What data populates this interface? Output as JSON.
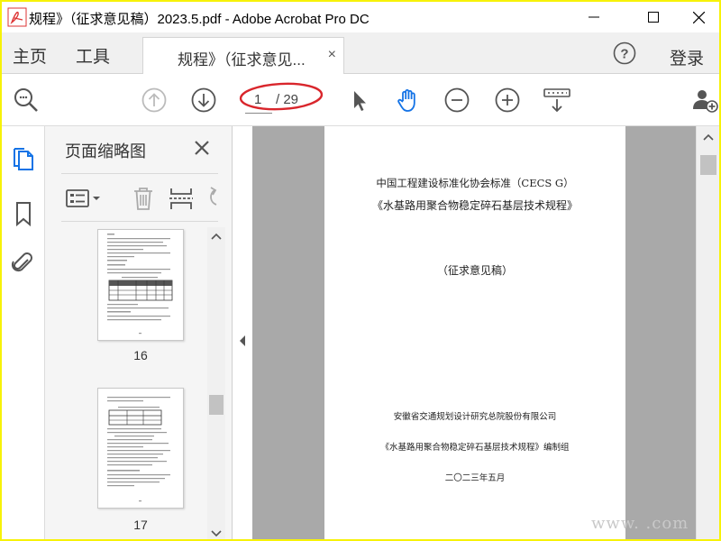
{
  "window": {
    "title": "规程》（征求意见稿）2023.5.pdf - Adobe Acrobat Pro DC",
    "minimize_icon": "minimize-icon",
    "maximize_icon": "maximize-icon",
    "close_icon": "close-icon",
    "frame_color": "#f7f208"
  },
  "tabs": {
    "home": "主页",
    "tools": "工具",
    "document": "规程》（征求意见...",
    "close": "×",
    "login": "登录"
  },
  "toolbar": {
    "current_page": "1",
    "total_pages": "/ 29",
    "icons": [
      "zoom-search-icon",
      "page-up-icon",
      "page-down-icon",
      "select-cursor-icon",
      "hand-tool-icon",
      "zoom-out-icon",
      "zoom-in-icon",
      "keyboard-scroll-icon",
      "share-user-icon"
    ],
    "active_color": "#1473e6"
  },
  "panel": {
    "title": "页面缩略图",
    "thumbnails": [
      {
        "page": "16"
      },
      {
        "page": "17"
      }
    ]
  },
  "document": {
    "line1": "中国工程建设标准化协会标准（CECS G）",
    "line2": "《水基路用聚合物稳定碎石基层技术规程》",
    "line3": "（征求意见稿）",
    "line4": "安徽省交通规划设计研究总院股份有限公司",
    "line5": "《水基路用聚合物稳定碎石基层技术规程》编制组",
    "line6": "二〇二三年五月"
  },
  "watermark": "www.        .com"
}
